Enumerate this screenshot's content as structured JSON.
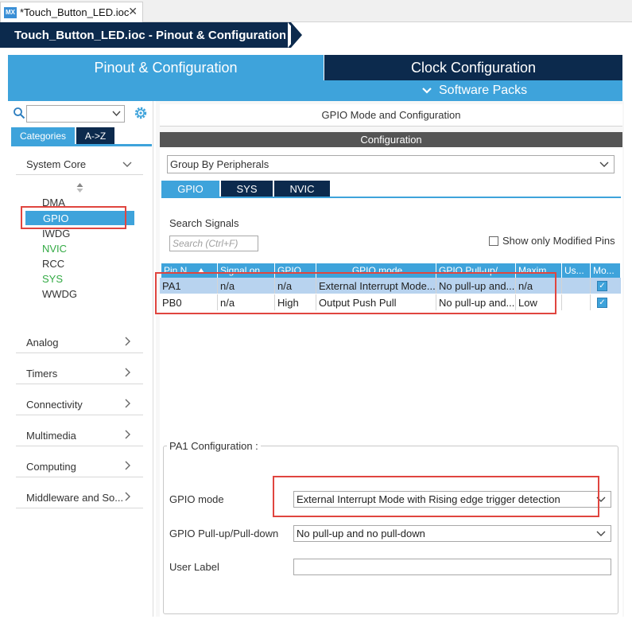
{
  "file_tab": {
    "icon_text": "MX",
    "label": "*Touch_Button_LED.ioc",
    "close": "✕"
  },
  "breadcrumb": {
    "title": "Touch_Button_LED.ioc - Pinout & Configuration"
  },
  "main_tabs": {
    "pinout": "Pinout & Configuration",
    "clock": "Clock Configuration",
    "software_packs": "Software Packs"
  },
  "left": {
    "tabs": {
      "categories": "Categories",
      "az": "A->Z"
    },
    "system_core": {
      "label": "System Core",
      "items": [
        "DMA",
        "GPIO",
        "IWDG",
        "NVIC",
        "RCC",
        "SYS",
        "WWDG"
      ]
    },
    "categories": [
      "Analog",
      "Timers",
      "Connectivity",
      "Multimedia",
      "Computing",
      "Middleware and So..."
    ]
  },
  "right": {
    "mode_title": "GPIO Mode and Configuration",
    "config_label": "Configuration",
    "group_by": "Group By Peripherals",
    "subtabs": [
      "GPIO",
      "SYS",
      "NVIC"
    ],
    "search_label": "Search Signals",
    "search_placeholder": "Search (Ctrl+F)",
    "show_modified": "Show only Modified Pins",
    "table": {
      "headers": [
        "Pin N...",
        "Signal on...",
        "GPIO ...",
        "GPIO mode",
        "GPIO Pull-up/...",
        "Maxim...",
        "Us...",
        "Mo..."
      ],
      "rows": [
        {
          "pin": "PA1",
          "signal": "n/a",
          "gpio": "n/a",
          "mode": "External Interrupt Mode...",
          "pull": "No pull-up and...",
          "max": "n/a",
          "user": "",
          "modified": "✓"
        },
        {
          "pin": "PB0",
          "signal": "n/a",
          "gpio": "High",
          "mode": "Output Push Pull",
          "pull": "No pull-up and...",
          "max": "Low",
          "user": "",
          "modified": "✓"
        }
      ]
    },
    "pa1": {
      "title": "PA1 Configuration :",
      "gpio_mode_label": "GPIO mode",
      "gpio_mode_value": "External Interrupt Mode with Rising edge trigger detection",
      "pull_label": "GPIO Pull-up/Pull-down",
      "pull_value": "No pull-up and no pull-down",
      "user_label": "User Label"
    }
  },
  "colors": {
    "accent": "#3ea3db",
    "navy": "#0c2a4d",
    "highlight": "#e0453f",
    "enabled_item": "#33aa44"
  }
}
